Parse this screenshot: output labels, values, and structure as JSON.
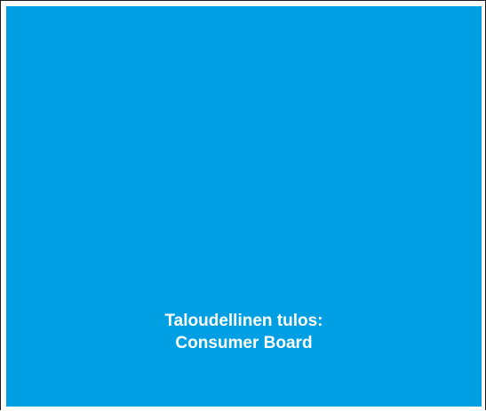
{
  "slide": {
    "background_color": "#009fe3",
    "text_color": "#ffffff",
    "title_line_1": "Taloudellinen tulos:",
    "title_line_2": "Consumer Board"
  }
}
